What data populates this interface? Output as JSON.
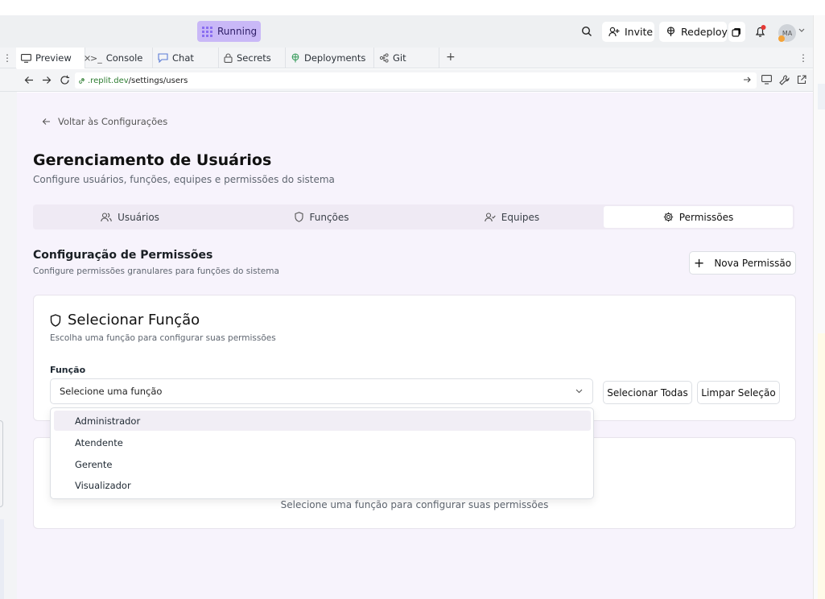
{
  "topbar": {
    "running_label": "Running",
    "invite_label": "Invite",
    "redeploy_label": "Redeploy",
    "avatar_initials": "MA"
  },
  "tabs": [
    {
      "label": "Preview",
      "close": "×"
    },
    {
      "label": "Console"
    },
    {
      "label": "Chat"
    },
    {
      "label": "Secrets"
    },
    {
      "label": "Deployments"
    },
    {
      "label": "Git"
    }
  ],
  "address": {
    "url_domain": ".replit.dev",
    "url_path": "/settings/users"
  },
  "page": {
    "back_link": "Voltar às Configurações",
    "title": "Gerenciamento de Usuários",
    "subtitle": "Configure usuários, funções, equipes e permissões do sistema",
    "segments": [
      "Usuários",
      "Funções",
      "Equipes",
      "Permissões"
    ],
    "section_title": "Configuração de Permissões",
    "section_subtitle": "Configure permissões granulares para funções do sistema",
    "new_permission_label": "Nova Permissão",
    "card": {
      "title": "Selecionar Função",
      "subtitle": "Escolha uma função para configurar suas permissões",
      "field_label": "Função",
      "select_placeholder": "Selecione uma função",
      "select_all_label": "Selecionar Todas",
      "clear_label": "Limpar Seleção"
    },
    "dropdown_options": [
      "Administrador",
      "Atendente",
      "Gerente",
      "Visualizador"
    ],
    "empty_message": "Selecione uma função para configurar suas permissões"
  },
  "colors": {
    "running_bg": "#c9b8f7",
    "page_bg": "#f7f3fc",
    "url_green": "#2e7d32"
  }
}
